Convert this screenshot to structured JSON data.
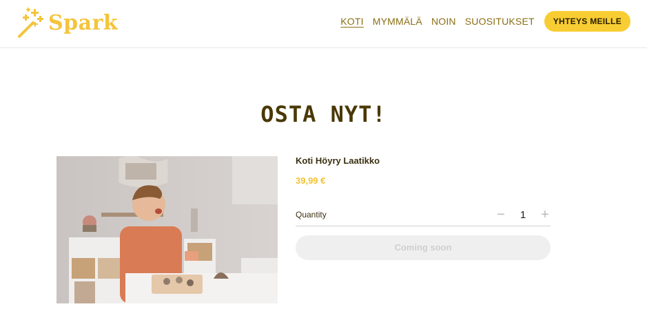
{
  "header": {
    "logo_text": "Spark",
    "nav": [
      {
        "label": "KOTI",
        "active": true
      },
      {
        "label": "MYMMÄLÄ",
        "active": false
      },
      {
        "label": "NOIN",
        "active": false
      },
      {
        "label": "SUOSITUKSET",
        "active": false
      }
    ],
    "contact_label": "YHTEYS MEILLE"
  },
  "main": {
    "title": "OSTA NYT!",
    "product": {
      "name": "Koti Höyry Laatikko",
      "price": "39,99 €",
      "quantity_label": "Quantity",
      "quantity_value": "1",
      "decrease_symbol": "−",
      "increase_symbol": "+",
      "button_label": "Coming soon"
    }
  },
  "colors": {
    "brand": "#f8cd33",
    "nav_text": "#8a6d12",
    "title": "#4a3806",
    "price": "#f2c232"
  },
  "icons": [
    "magic-wand-icon",
    "minus-icon",
    "plus-icon"
  ]
}
